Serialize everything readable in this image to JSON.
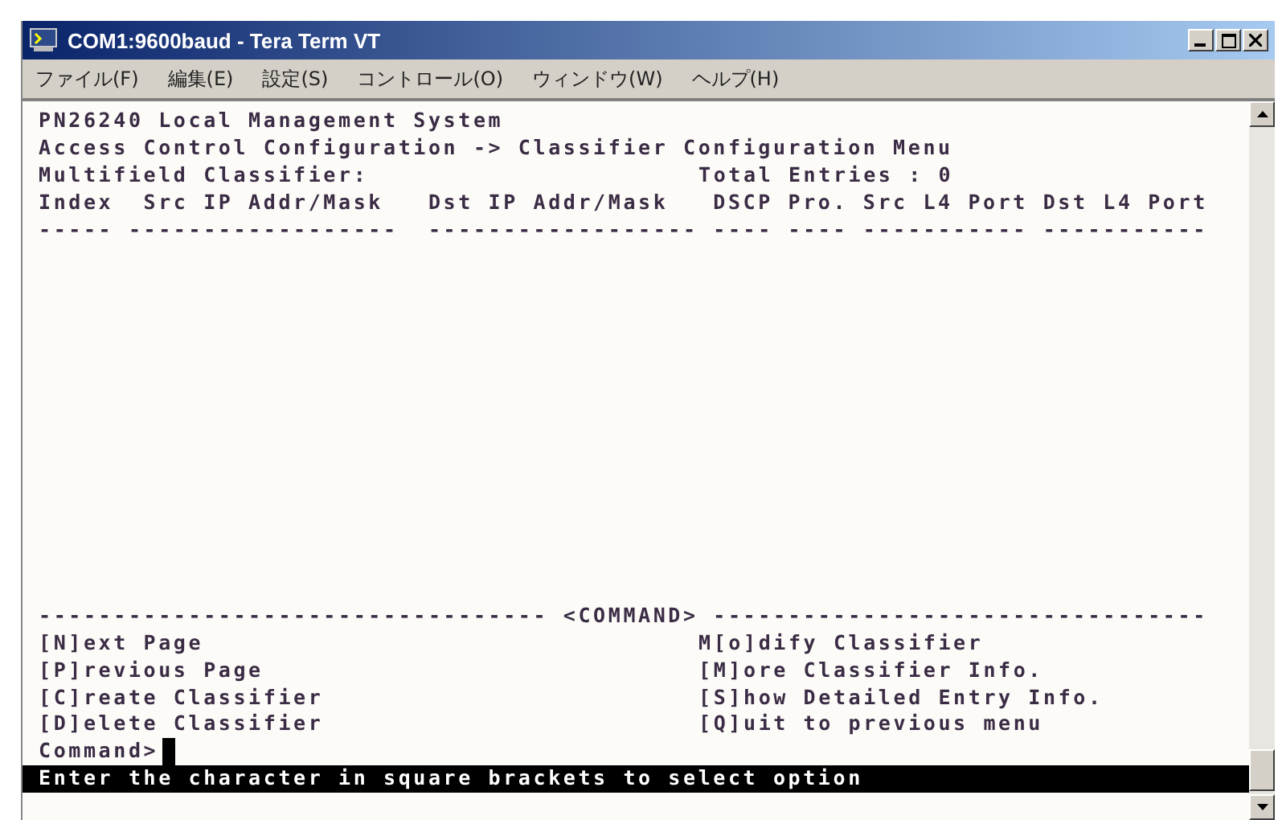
{
  "window": {
    "title": "COM1:9600baud - Tera Term VT"
  },
  "menu": [
    "ファイル(F)",
    "編集(E)",
    "設定(S)",
    "コントロール(O)",
    "ウィンドウ(W)",
    "ヘルプ(H)"
  ],
  "terminal": {
    "header_lines": [
      "PN26240 Local Management System",
      "Access Control Configuration -> Classifier Configuration Menu"
    ],
    "section_label": "Multifield Classifier:",
    "total_entries": "Total Entries : 0",
    "column_headers": "Index  Src IP Addr/Mask   Dst IP Addr/Mask   DSCP Pro. Src L4 Port Dst L4 Port",
    "column_rules": "----- ------------------  ------------------ ---- ---- ----------- -----------",
    "command_divider": "---------------------------------- <COMMAND> ---------------------------------",
    "commands_left": [
      "[N]ext Page",
      "[P]revious Page",
      "[C]reate Classifier",
      "[D]elete Classifier"
    ],
    "commands_right": [
      "M[o]dify Classifier",
      "[M]ore Classifier Info.",
      "[S]how Detailed Entry Info.",
      "[Q]uit to previous menu"
    ],
    "prompt": "Command>",
    "status_line": "Enter the character in square brackets to select option"
  }
}
